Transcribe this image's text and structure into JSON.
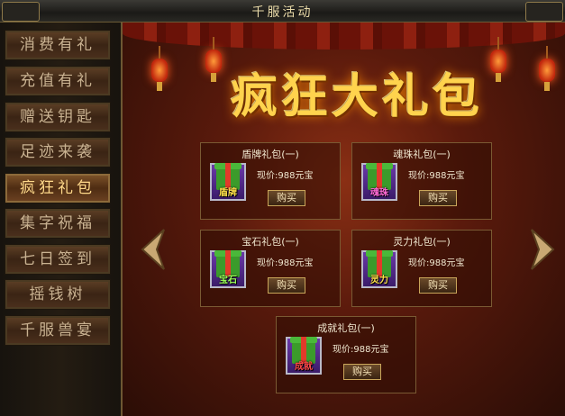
{
  "window": {
    "title": "千服活动"
  },
  "sidebar": {
    "items": [
      {
        "label": "消费有礼"
      },
      {
        "label": "充值有礼"
      },
      {
        "label": "赠送钥匙"
      },
      {
        "label": "足迹来袭"
      },
      {
        "label": "疯狂礼包",
        "active": true
      },
      {
        "label": "集字祝福"
      },
      {
        "label": "七日签到"
      },
      {
        "label": "摇钱树"
      },
      {
        "label": "千服兽宴"
      }
    ]
  },
  "banner": {
    "title": "疯狂大礼包"
  },
  "packs": [
    {
      "name": "盾牌礼包(一)",
      "icon_text": "盾牌",
      "price": "现价:988元宝",
      "buy_label": "购买"
    },
    {
      "name": "魂珠礼包(一)",
      "icon_text": "魂珠",
      "price": "现价:988元宝",
      "buy_label": "购买"
    },
    {
      "name": "宝石礼包(一)",
      "icon_text": "宝石",
      "price": "现价:988元宝",
      "buy_label": "购买"
    },
    {
      "name": "灵力礼包(一)",
      "icon_text": "灵力",
      "price": "现价:988元宝",
      "buy_label": "购买"
    },
    {
      "name": "成就礼包(一)",
      "icon_text": "成就",
      "price": "现价:988元宝",
      "buy_label": "购买"
    }
  ],
  "colors": {
    "accent_gold": "#ffd34d",
    "panel_red": "#5a1a0c"
  }
}
